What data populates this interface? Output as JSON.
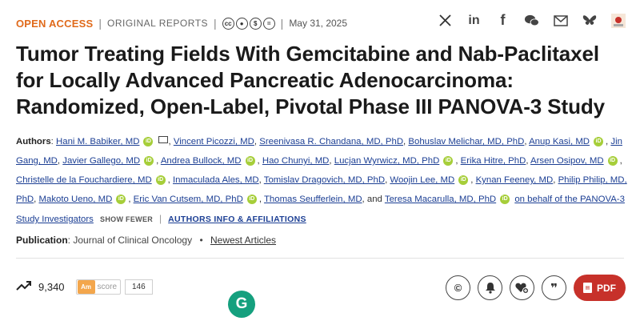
{
  "topbar": {
    "open_access": "OPEN ACCESS",
    "separator": "|",
    "report_type": "ORIGINAL REPORTS",
    "license_icons": [
      "cc",
      "by",
      "nc",
      "nd"
    ],
    "date": "May 31, 2025",
    "share_icons": [
      "x-icon",
      "linkedin-icon",
      "facebook-icon",
      "wechat-icon",
      "email-icon",
      "bluesky-icon",
      "mendeley-icon"
    ]
  },
  "title": "Tumor Treating Fields With Gemcitabine and Nab-Paclitaxel for Locally Advanced Pancreatic Adenocarcinoma: Randomized, Open-Label, Pivotal Phase III PANOVA-3 Study",
  "authors": {
    "label": "Authors",
    "list": [
      "Hani M. Babiker, MD",
      "Vincent Picozzi, MD",
      "Sreenivasa R. Chandana, MD, PhD",
      "Bohuslav Melichar, MD, PhD",
      "Anup Kasi, MD",
      "Jin Gang, MD",
      "Javier Gallego, MD",
      "Andrea Bullock, MD",
      "Hao Chunyi, MD",
      "Lucjan Wyrwicz, MD, PhD",
      "Erika Hitre, PhD",
      "Arsen Osipov, MD",
      "Christelle de la Fouchardiere, MD",
      "Inmaculada Ales, MD",
      "Tomislav Dragovich, MD, PhD",
      "Woojin Lee, MD",
      "Kynan Feeney, MD",
      "Philip Philip, MD, PhD",
      "Makoto Ueno, MD",
      "Eric Van Cutsem, MD, PhD",
      "Thomas Seufferlein, MD",
      "Teresa Macarulla, MD, PhD"
    ],
    "and": "and",
    "group": "on behalf of the PANOVA-3 Study Investigators",
    "show_fewer": "SHOW FEWER",
    "affiliations": "AUTHORS INFO & AFFILIATIONS"
  },
  "publication": {
    "label": "Publication",
    "journal": "Journal of Clinical Oncology",
    "section": "Newest Articles"
  },
  "metrics": {
    "views": "9,340",
    "altmetric_label": "score",
    "altmetric_value": "146"
  },
  "actions": {
    "pdf_label": "PDF"
  },
  "colors": {
    "open_access": "#e06a1b",
    "link": "#1c3f94",
    "pdf_button": "#c7312a",
    "orcid": "#a6ce39"
  }
}
